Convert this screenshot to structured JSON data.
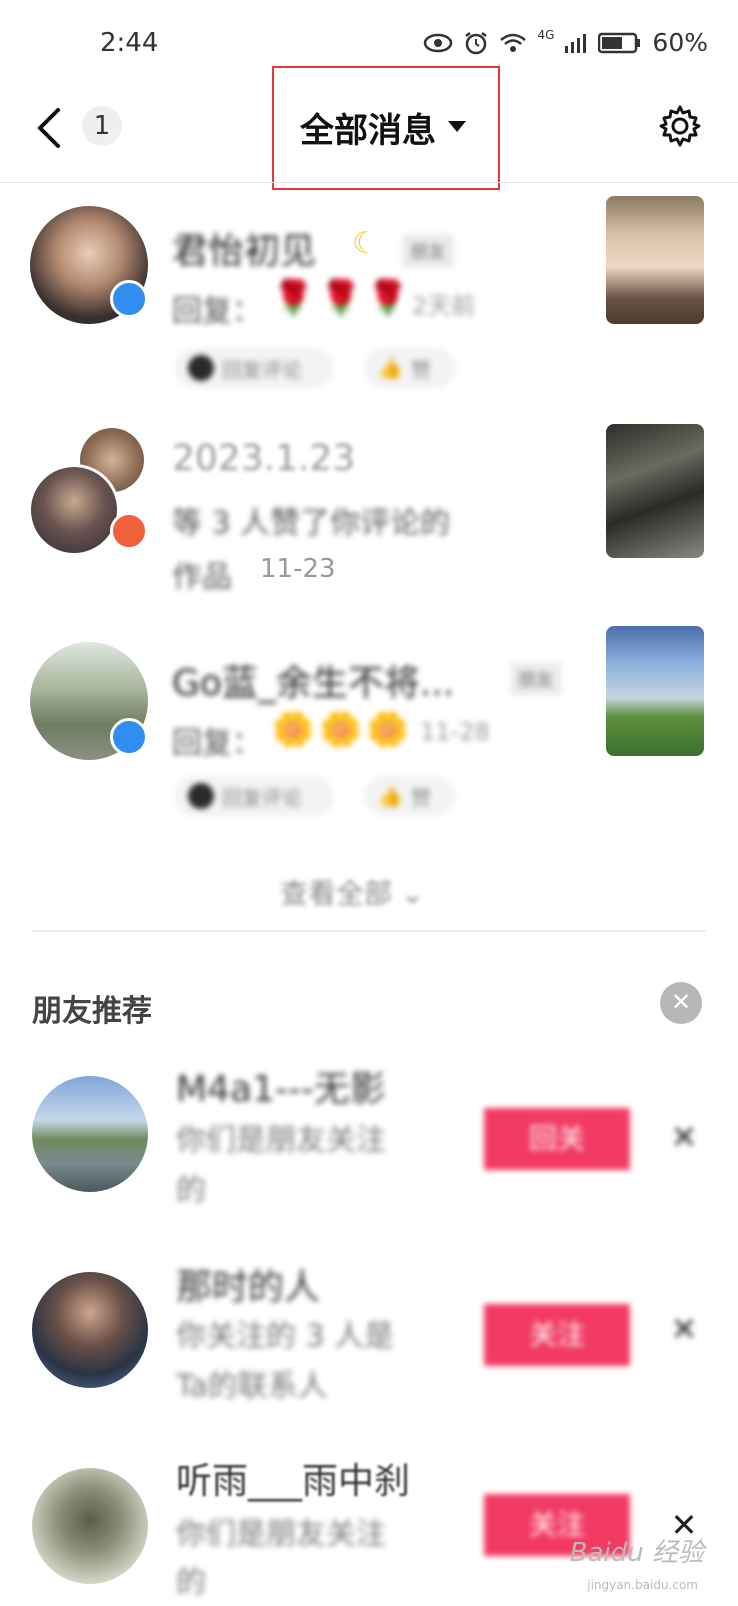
{
  "status_bar": {
    "time": "2:44",
    "network": "4G",
    "battery": "60%"
  },
  "header": {
    "back_count": "1",
    "title": "全部消息"
  },
  "notifications": [
    {
      "name": "君怡初见",
      "tag": "朋友",
      "sub": "回复：",
      "emoji": "🌹",
      "time": "2天前",
      "chip_text": "回复评论",
      "chip2": "赞"
    },
    {
      "name": "2023.1.23",
      "sub_line1": "等 3 人赞了你评论的",
      "sub_line2": "作品",
      "time": "11-23"
    },
    {
      "name": "Go蓝_余生不将...",
      "tag": "朋友",
      "sub": "回复：",
      "emoji": "🌼",
      "time": "11-28",
      "chip_text": "回复评论",
      "chip2": "赞"
    }
  ],
  "see_all": "查看全部 ⌄",
  "friends_section": {
    "title": "朋友推荐",
    "items": [
      {
        "name": "M4a1---无影",
        "desc1": "你们是朋友关注",
        "desc2": "的",
        "button": "回关"
      },
      {
        "name": "那时的人",
        "desc1": "你关注的 3 人是",
        "desc2": "Ta的联系人",
        "button": "关注"
      },
      {
        "name": "听雨___雨中刹",
        "desc1": "你们是朋友关注",
        "desc2": "的",
        "button": "关注"
      }
    ]
  },
  "watermark": "Baidu 经验",
  "watermark_sub": "jingyan.baidu.com",
  "colors": {
    "accent": "#f23a63",
    "highlight_box": "#e53935"
  }
}
